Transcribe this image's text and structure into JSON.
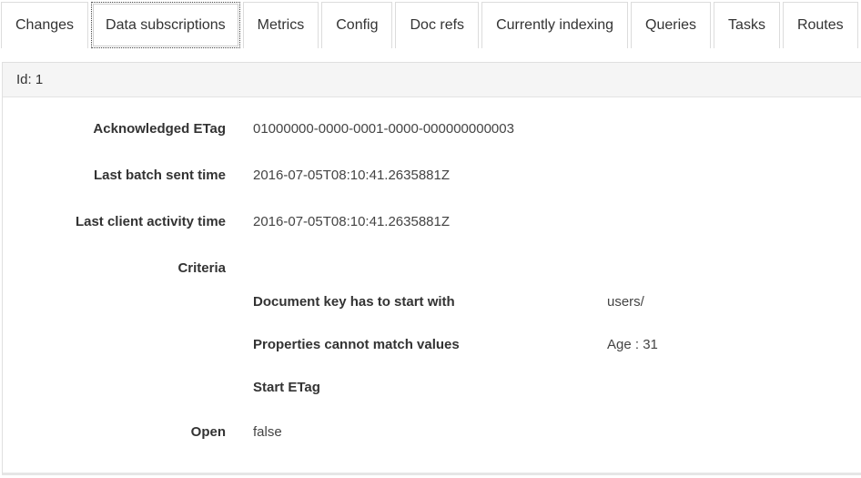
{
  "tabs": [
    {
      "label": "Changes",
      "active": false
    },
    {
      "label": "Data subscriptions",
      "active": true
    },
    {
      "label": "Metrics",
      "active": false
    },
    {
      "label": "Config",
      "active": false
    },
    {
      "label": "Doc refs",
      "active": false
    },
    {
      "label": "Currently indexing",
      "active": false
    },
    {
      "label": "Queries",
      "active": false
    },
    {
      "label": "Tasks",
      "active": false
    },
    {
      "label": "Routes",
      "active": false
    }
  ],
  "subscription": {
    "heading": "Id: 1",
    "acknowledged_etag": {
      "label": "Acknowledged ETag",
      "value": "01000000-0000-0001-0000-000000000003"
    },
    "last_batch_sent_time": {
      "label": "Last batch sent time",
      "value": "2016-07-05T08:10:41.2635881Z"
    },
    "last_client_activity_time": {
      "label": "Last client activity time",
      "value": "2016-07-05T08:10:41.2635881Z"
    },
    "criteria": {
      "label": "Criteria",
      "items": [
        {
          "label": "Document key has to start with",
          "value": "users/"
        },
        {
          "label": "Properties cannot match values",
          "value": "Age : 31"
        },
        {
          "label": "Start ETag",
          "value": ""
        }
      ]
    },
    "open": {
      "label": "Open",
      "value": "false"
    }
  }
}
